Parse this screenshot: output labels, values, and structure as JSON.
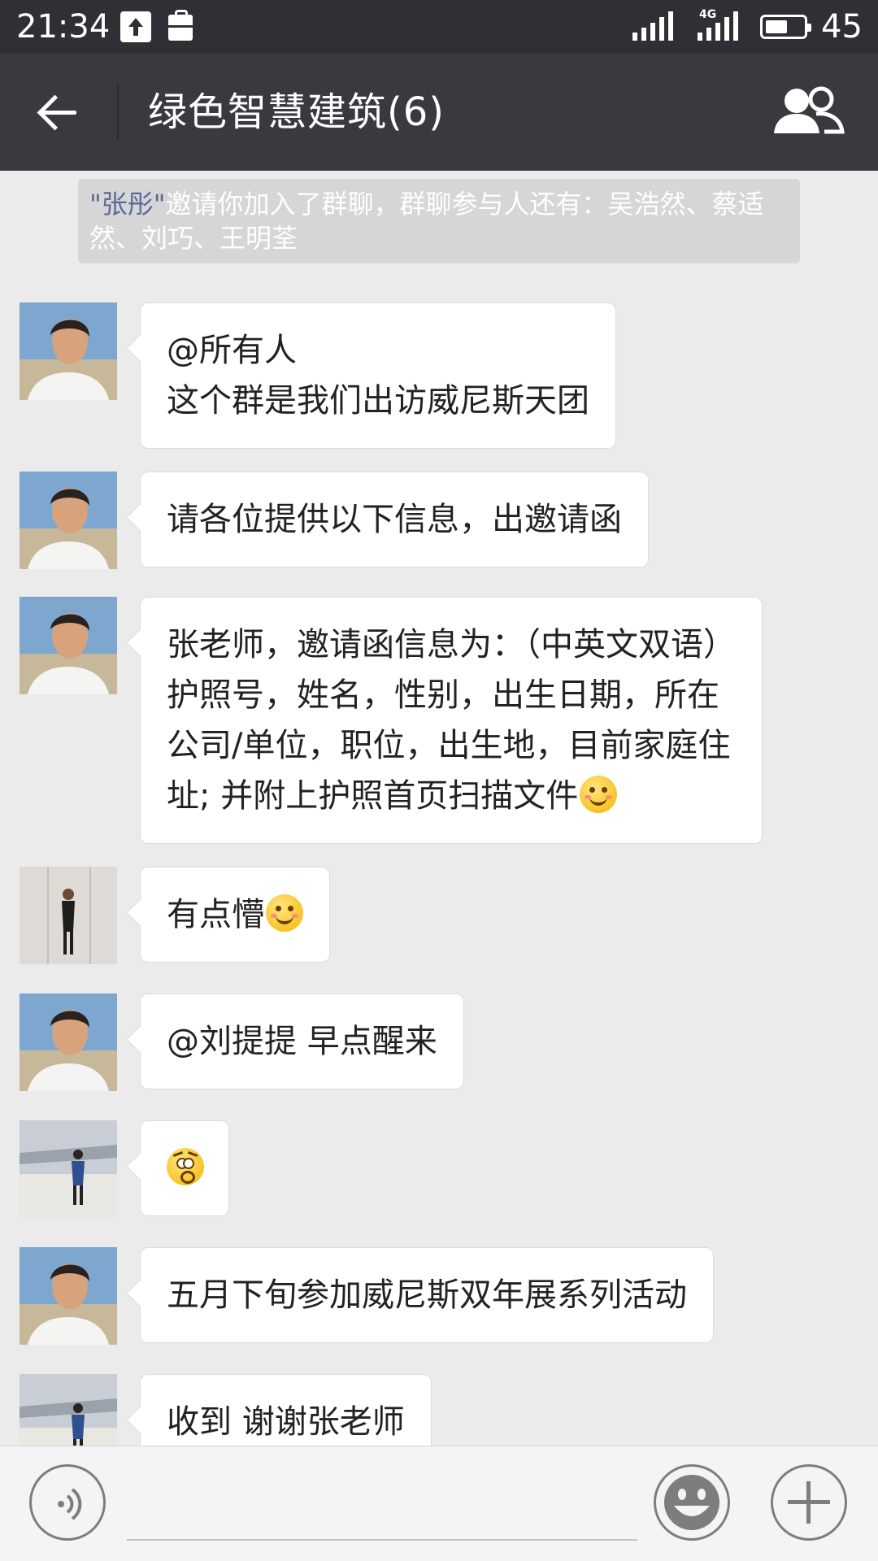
{
  "status_bar": {
    "time": "21:34",
    "network": "4G",
    "battery_level": "45",
    "icons": [
      "upload-icon",
      "bag-icon",
      "signal-icon",
      "signal-4g-icon",
      "battery-icon"
    ]
  },
  "header": {
    "title": "绿色智慧建筑(6)",
    "icons": [
      "back-arrow-icon",
      "group-members-icon"
    ]
  },
  "system_notice": {
    "inviter": "\"张彤\"",
    "text": "邀请你加入了群聊，群聊参与人还有：吴浩然、蔡适然、刘巧、王明荃"
  },
  "messages": [
    {
      "avatar": "avatar-zhang",
      "lines": [
        "@所有人",
        "这个群是我们出访威尼斯天团"
      ]
    },
    {
      "avatar": "avatar-zhang",
      "lines": [
        "请各位提供以下信息，出邀请函"
      ]
    },
    {
      "avatar": "avatar-zhang",
      "lines": [
        "张老师，邀请函信息为：（中英文双语）",
        "护照号，姓名，性别，出生日期，所在",
        "公司/单位，职位，出生地，目前家庭住",
        "址; 并附上护照首页扫描文件"
      ],
      "trailing_emoji": "smile-emoji"
    },
    {
      "avatar": "avatar-woman",
      "lines": [
        "有点懵"
      ],
      "trailing_emoji": "smile-emoji"
    },
    {
      "avatar": "avatar-zhang",
      "lines": [
        "@刘提提  早点醒来"
      ]
    },
    {
      "avatar": "avatar-blue-jacket",
      "lines": [
        ""
      ],
      "trailing_emoji": "shocked-emoji"
    },
    {
      "avatar": "avatar-zhang",
      "lines": [
        "五月下旬参加威尼斯双年展系列活动"
      ]
    },
    {
      "avatar": "avatar-blue-jacket",
      "lines": [
        "收到 谢谢张老师"
      ]
    }
  ],
  "input_bar": {
    "text_value": "",
    "icons": [
      "voice-icon",
      "emoji-icon",
      "plus-icon"
    ]
  },
  "colors": {
    "status_bar_bg": "#2e3033",
    "title_bar_bg": "#393a3f",
    "chat_bg": "#ebebeb",
    "bubble_bg": "#ffffff",
    "notice_bg": "#d6d6d6",
    "notice_name": "#5b6b96"
  }
}
